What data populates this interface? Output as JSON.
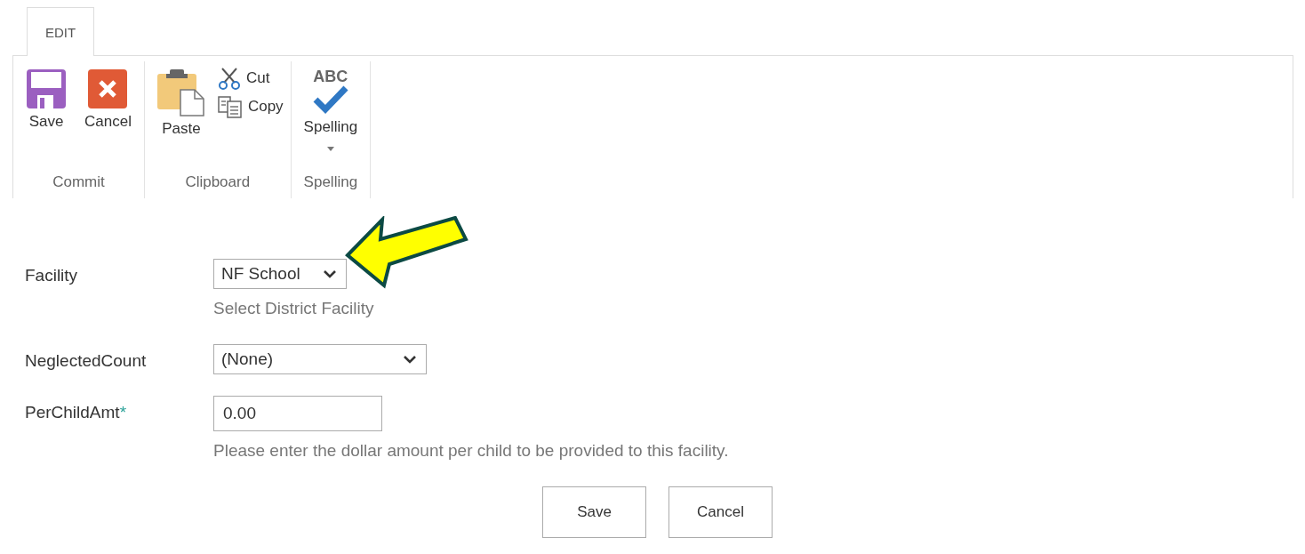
{
  "ribbon": {
    "tabs": [
      {
        "label": "EDIT",
        "selected": true
      }
    ],
    "groups": [
      {
        "label": "Commit",
        "buttons": [
          {
            "kind": "save",
            "label": "Save"
          },
          {
            "kind": "cancel",
            "label": "Cancel"
          }
        ]
      },
      {
        "label": "Clipboard",
        "buttons": [
          {
            "kind": "paste",
            "label": "Paste"
          },
          {
            "kind": "cut",
            "label": "Cut"
          },
          {
            "kind": "copy",
            "label": "Copy"
          }
        ]
      },
      {
        "label": "Spelling",
        "buttons": [
          {
            "kind": "spelling",
            "label": "Spelling",
            "icon_text": "ABC"
          }
        ]
      }
    ]
  },
  "form": {
    "fields": [
      {
        "kind": "select",
        "label": "Facility",
        "value": "NF School",
        "hint": "Select District Facility",
        "annotated": true
      },
      {
        "kind": "select",
        "label": "NeglectedCount",
        "value": "(None)"
      },
      {
        "kind": "text",
        "label": "PerChildAmt",
        "required_mark": "*",
        "value": "0.00",
        "hint": "Please enter the dollar amount per child to be provided to this facility."
      }
    ],
    "buttons": [
      "Save",
      "Cancel"
    ]
  }
}
